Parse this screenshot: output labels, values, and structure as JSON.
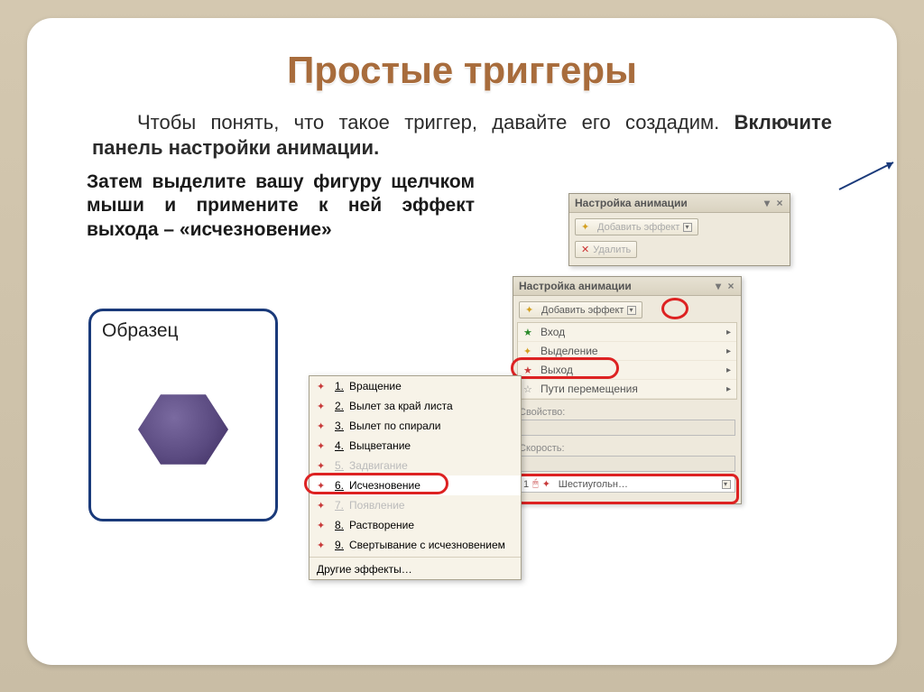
{
  "title": "Простые триггеры",
  "para1_a": "Чтобы понять, что такое триггер, давайте его создадим. ",
  "para1_b": "Включите панель настройки анимации.",
  "para2": "Затем выделите вашу фигуру щелчком мыши и примените к ней эффект выхода – «исчезновение»",
  "sample_label": "Образец",
  "panel1": {
    "title": "Настройка анимации",
    "add": "Добавить эффект",
    "del": "Удалить"
  },
  "panel2": {
    "title": "Настройка анимации",
    "add": "Добавить эффект",
    "m1": "Вход",
    "m2": "Выделение",
    "m3": "Выход",
    "m4": "Пути перемещения",
    "prop": "Свойство:",
    "speed": "Скорость:",
    "objnum": "1",
    "objname": "Шестиугольн…"
  },
  "effects": {
    "e1": "Вращение",
    "e2": "Вылет за край листа",
    "e3": "Вылет по спирали",
    "e4": "Выцветание",
    "e5": "Задвигание",
    "e6": "Исчезновение",
    "e7": "Появление",
    "e8": "Растворение",
    "e9": "Свертывание с исчезновением",
    "more": "Другие эффекты…",
    "n1": "1.",
    "n2": "2.",
    "n3": "3.",
    "n4": "4.",
    "n5": "5.",
    "n6": "6.",
    "n7": "7.",
    "n8": "8.",
    "n9": "9."
  },
  "glyph_tri": "▾",
  "glyph_x": "×"
}
